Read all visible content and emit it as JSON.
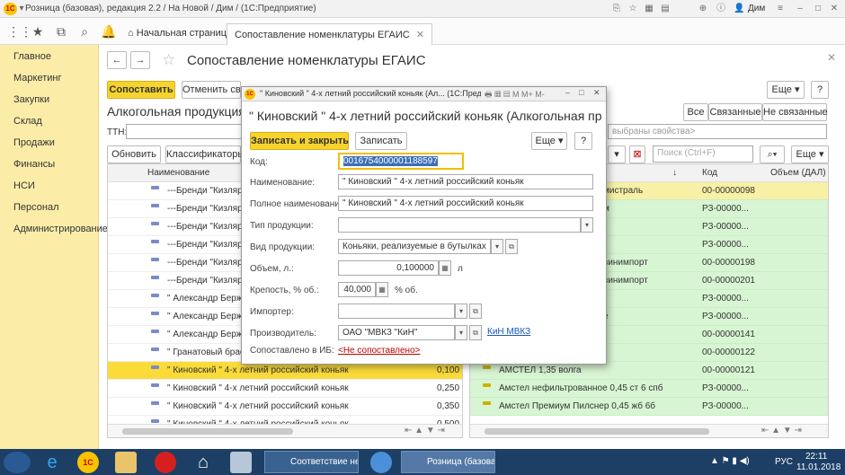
{
  "app": {
    "title": "Розница (базовая), редакция 2.2 / На Новой / Дим / (1С:Предприятие)",
    "user": "Дим"
  },
  "tabs": {
    "home": "Начальная страница",
    "active": "Сопоставление номенклатуры ЕГАИС"
  },
  "sidebar": {
    "items": [
      "Главное",
      "Маркетинг",
      "Закупки",
      "Склад",
      "Продажи",
      "Финансы",
      "НСИ",
      "Персонал",
      "Администрирование"
    ]
  },
  "main": {
    "title": "Сопоставление номенклатуры ЕГАИС",
    "compare_btn": "Сопоставить",
    "cancel_btn": "Отменить связь",
    "more_btn": "Еще",
    "help_btn": "?",
    "filters": [
      "Все",
      "Связанные",
      "Не связанные"
    ],
    "left_panel_title": "Алкогольная продукция",
    "ttn_label": "ТТН:",
    "refresh_btn": "Обновить",
    "classifiers_btn": "Классификаторы",
    "col_name": "Наименование",
    "left_rows": [
      {
        "name": "---Бренди \"Кизляр",
        "val": ""
      },
      {
        "name": "---Бренди \"Кизляр",
        "val": ""
      },
      {
        "name": "---Бренди \"Кизляр",
        "val": ""
      },
      {
        "name": "---Бренди \"Кизляр",
        "val": ""
      },
      {
        "name": "---Бренди \"Кизляр",
        "val": ""
      },
      {
        "name": "---Бренди \"Кизляр",
        "val": ""
      },
      {
        "name": "\" Александр Берже",
        "val": ""
      },
      {
        "name": "\" Александр Берже",
        "val": ""
      },
      {
        "name": "\" Александр Берже",
        "val": ""
      },
      {
        "name": "\" Гранатовый брасл",
        "val": ""
      },
      {
        "name": "\" Киновский \" 4-х летний российский коньяк",
        "val": "0,100"
      },
      {
        "name": "\" Киновский \" 4-х летний российский коньяк",
        "val": "0,250"
      },
      {
        "name": "\" Киновский \" 4-х летний российский коньяк",
        "val": "0,350"
      },
      {
        "name": "\" Киновский \" 4-х летний российский коньяк",
        "val": "0,500"
      }
    ],
    "right_filter_placeholder": "выбраны свойства>",
    "search_placeholder": "Поиск (Ctrl+F)",
    "col_code": "Код",
    "col_volume": "Объем (ДАЛ)",
    "right_rows": [
      {
        "name": "мистраль",
        "code": "00-00000098"
      },
      {
        "name": "м",
        "code": "РЗ-00000..."
      },
      {
        "name": "",
        "code": "РЗ-00000..."
      },
      {
        "name": "",
        "code": "РЗ-00000..."
      },
      {
        "name": "винимпорт",
        "code": "00-00000198"
      },
      {
        "name": "винимпорт",
        "code": "00-00000201"
      },
      {
        "name": "",
        "code": "РЗ-00000..."
      },
      {
        "name": "е",
        "code": "РЗ-00000..."
      },
      {
        "name": "",
        "code": "00-00000141"
      },
      {
        "name": "АМСТЕЛ 0,5 Ст 6 волга",
        "code": "00-00000122"
      },
      {
        "name": "АМСТЕЛ 1,35 волга",
        "code": "00-00000121"
      },
      {
        "name": "Амстел нефильтрованное 0,45 ст 6 спб",
        "code": "РЗ-00000..."
      },
      {
        "name": "Амстел Премиум Пилснер 0,45 жб 6б",
        "code": "РЗ-00000..."
      }
    ]
  },
  "modal": {
    "window_title": "\" Киновский \" 4-х летний российский коньяк (Ал... (1С:Предприятие)",
    "heading": "\" Киновский \" 4-х летний российский коньяк (Алкогольная прод...",
    "save_close_btn": "Записать и закрыть",
    "save_btn": "Записать",
    "more_btn": "Еще",
    "help_btn": "?",
    "fields": {
      "code": {
        "label": "Код:",
        "value": "0016754000001188597"
      },
      "name": {
        "label": "Наименование:",
        "value": "\" Киновский \" 4-х летний российский коньяк"
      },
      "full_name": {
        "label": "Полное наименование:",
        "value": "\" Киновский \" 4-х летний российский коньяк"
      },
      "type": {
        "label": "Тип продукции:",
        "value": ""
      },
      "kind": {
        "label": "Вид продукции:",
        "value": "Коньяки, реализуемые в бутылках"
      },
      "volume": {
        "label": "Объем, л.:",
        "value": "0,100000",
        "unit": "л"
      },
      "strength": {
        "label": "Крепость, % об.:",
        "value": "40,000",
        "unit": "% об."
      },
      "importer": {
        "label": "Импортер:",
        "value": ""
      },
      "producer": {
        "label": "Производитель:",
        "value": "ОАО \"МВКЗ \"КиН\"",
        "link": "КиН МВКЗ"
      },
      "matched": {
        "label": "Сопоставлено в ИБ:",
        "value": "<Не сопоставлено>"
      }
    }
  },
  "taskbar": {
    "win1": "Соответствие не...",
    "win2": "Розница (базова...",
    "lang": "РУС",
    "time": "22:11",
    "date": "11.01.2018"
  },
  "colors": {
    "accent": "#f6d32d",
    "sidebar": "#fbeda8",
    "selected_row": "#fbdb3a",
    "linked_row": "#d8f5d3",
    "link": "#1a56b6",
    "not_matched": "#c00000"
  }
}
